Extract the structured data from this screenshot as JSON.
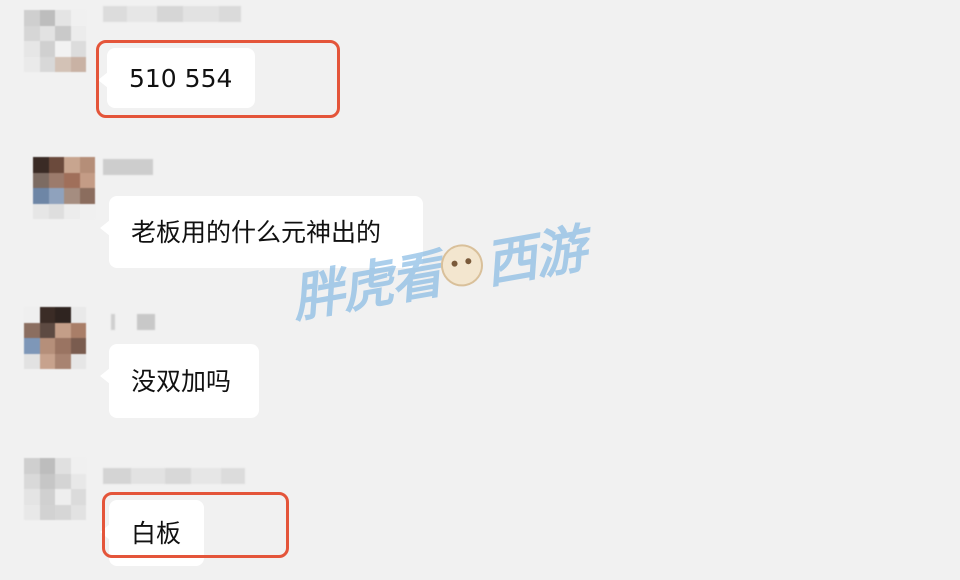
{
  "messages": [
    {
      "text": "510 554",
      "highlighted": true
    },
    {
      "text": "老板用的什么元神出的",
      "highlighted": false
    },
    {
      "text": "没双加吗",
      "highlighted": false
    },
    {
      "text": "白板",
      "highlighted": true
    }
  ],
  "watermark": {
    "left_text": "胖虎看",
    "right_text": "西游"
  },
  "colors": {
    "background": "#f1f1f1",
    "bubble": "#ffffff",
    "highlight_box": "#e4553a",
    "watermark": "#78b2e1"
  }
}
